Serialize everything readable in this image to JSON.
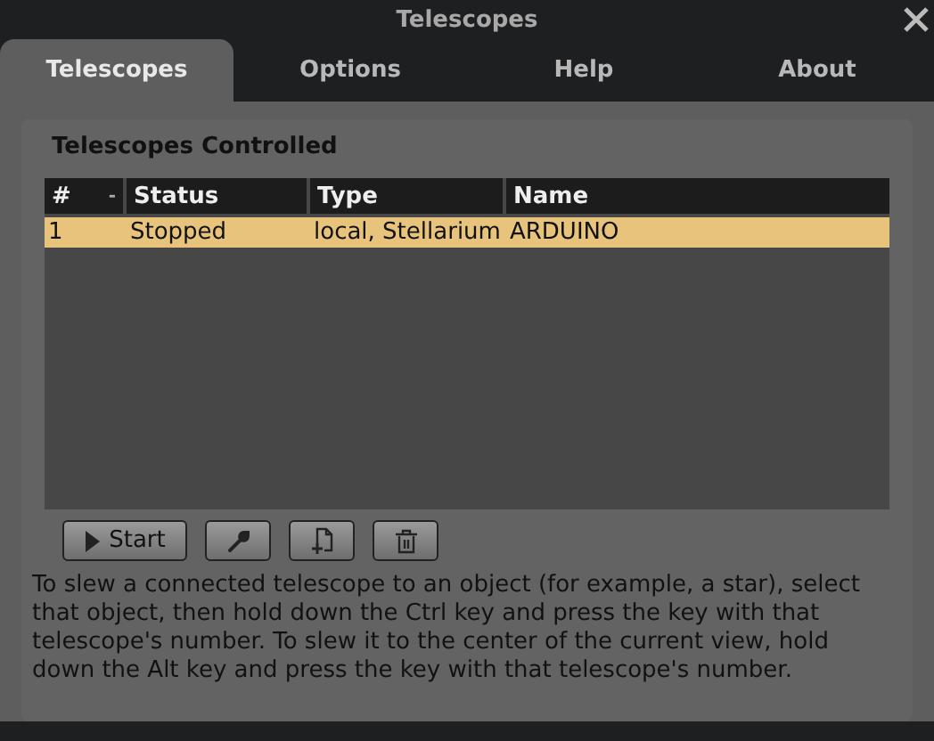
{
  "window": {
    "title": "Telescopes"
  },
  "tabs": [
    {
      "label": "Telescopes",
      "selected": true
    },
    {
      "label": "Options",
      "selected": false
    },
    {
      "label": "Help",
      "selected": false
    },
    {
      "label": "About",
      "selected": false
    }
  ],
  "section_title": "Telescopes Controlled",
  "table": {
    "columns": [
      {
        "label": "#",
        "sort_indicator": "-"
      },
      {
        "label": "Status"
      },
      {
        "label": "Type"
      },
      {
        "label": "Name"
      }
    ],
    "rows": [
      {
        "cells": [
          "1",
          "Stopped",
          "local, Stellarium",
          "ARDUINO"
        ],
        "selected": true
      }
    ]
  },
  "buttons": [
    {
      "kind": "start",
      "label": "Start"
    },
    {
      "kind": "configure"
    },
    {
      "kind": "add"
    },
    {
      "kind": "remove"
    }
  ],
  "help_text": "To slew a connected telescope to an object (for example, a star), select that object, then hold down the Ctrl key and press the key with that telescope's number. To slew it to the center of the current view, hold down the Alt key and press the key with that telescope's number."
}
